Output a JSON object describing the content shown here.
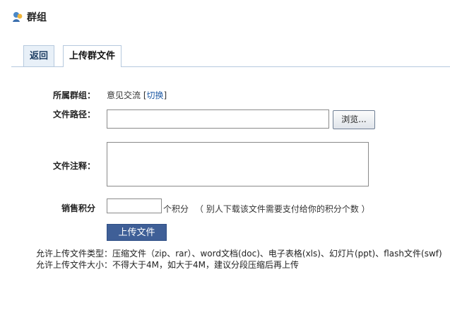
{
  "header": {
    "title": "群组",
    "icon": "group-icon"
  },
  "tabs": [
    {
      "label": "返回"
    },
    {
      "label": "上传群文件"
    }
  ],
  "form": {
    "group_label": "所属群组：",
    "group_value": "意见交流",
    "switch_open": "[",
    "switch_link": "切换",
    "switch_close": "]",
    "path_label": "文件路径：",
    "path_value": "",
    "browse_label": "浏览...",
    "note_label": "文件注释：",
    "note_value": "",
    "score_label": "销售积分",
    "score_value": "",
    "score_unit": "个积分",
    "score_hint": "（ 别人下载该文件需要支付给你的积分个数 ）",
    "submit_label": "上传文件"
  },
  "info": {
    "types_line": "允许上传文件类型：压缩文件（zip、rar）、word文档(doc)、电子表格(xls)、幻灯片(ppt)、flash文件(swf)",
    "size_line": "允许上传文件大小：不得大于4M，如大于4M，建议分段压缩后再上传"
  },
  "colors": {
    "primary": "#3f5f97",
    "link": "#1f5aa5",
    "tab_border": "#b6c9de"
  }
}
